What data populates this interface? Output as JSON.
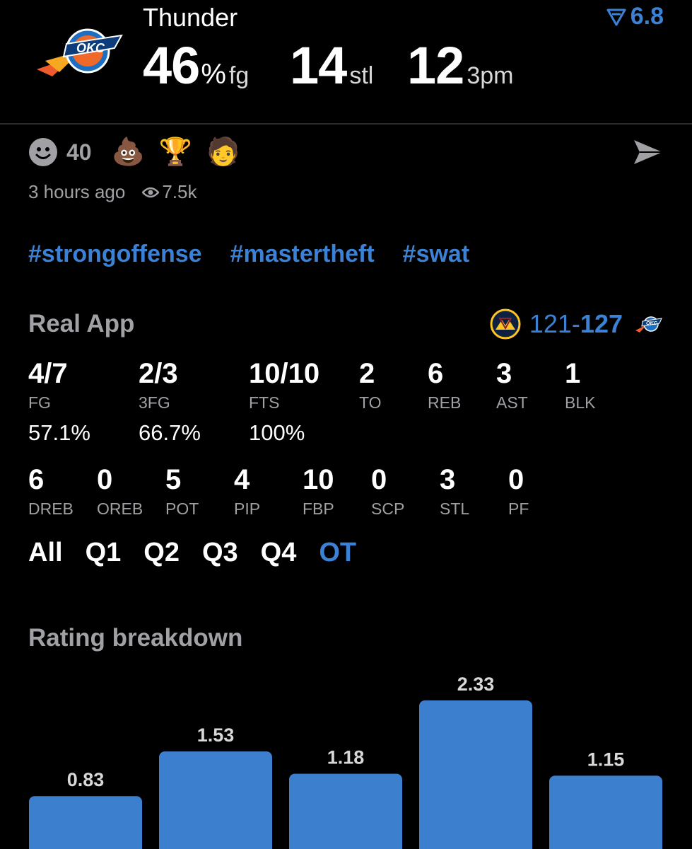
{
  "header": {
    "team": "Thunder",
    "rating_value": "6.8",
    "stats": [
      {
        "value": "46",
        "suffix": "%",
        "unit": "fg"
      },
      {
        "value": "14",
        "suffix": "",
        "unit": "stl"
      },
      {
        "value": "12",
        "suffix": "",
        "unit": "3pm"
      }
    ]
  },
  "reactions": {
    "count": "40",
    "emojis": [
      "💩",
      "🏆",
      "🧑"
    ],
    "emoji_icons": [
      "poop-icon",
      "trophy-icon",
      "face-photo-icon"
    ]
  },
  "meta": {
    "time": "3 hours ago",
    "views": "7.5k"
  },
  "tags": [
    "#strongoffense",
    "#mastertheft",
    "#swat"
  ],
  "boxscore": {
    "title": "Real App",
    "score_left": "121",
    "score_sep": "-",
    "score_right": "127",
    "row1": [
      {
        "value": "4/7",
        "label": "FG"
      },
      {
        "value": "2/3",
        "label": "3FG"
      },
      {
        "value": "10/10",
        "label": "FTS"
      },
      {
        "value": "2",
        "label": "TO"
      },
      {
        "value": "6",
        "label": "REB"
      },
      {
        "value": "3",
        "label": "AST"
      },
      {
        "value": "1",
        "label": "BLK"
      }
    ],
    "percentages": [
      "57.1%",
      "66.7%",
      "100%"
    ],
    "row2": [
      {
        "value": "6",
        "label": "DREB"
      },
      {
        "value": "0",
        "label": "OREB"
      },
      {
        "value": "5",
        "label": "POT"
      },
      {
        "value": "4",
        "label": "PIP"
      },
      {
        "value": "10",
        "label": "FBP"
      },
      {
        "value": "0",
        "label": "SCP"
      },
      {
        "value": "3",
        "label": "STL"
      },
      {
        "value": "0",
        "label": "PF"
      }
    ]
  },
  "quarters": [
    "All",
    "Q1",
    "Q2",
    "Q3",
    "Q4",
    "OT"
  ],
  "active_quarter": "OT",
  "colors": {
    "accent": "#3b82d6",
    "bar": "#3d7fcf",
    "muted": "#a0a0a5"
  },
  "breakdown": {
    "title": "Rating breakdown"
  },
  "chart_data": {
    "type": "bar",
    "values": [
      0.83,
      1.53,
      1.18,
      2.33,
      1.15
    ],
    "data_labels": [
      "0.83",
      "1.53",
      "1.18",
      "2.33",
      "1.15"
    ]
  }
}
